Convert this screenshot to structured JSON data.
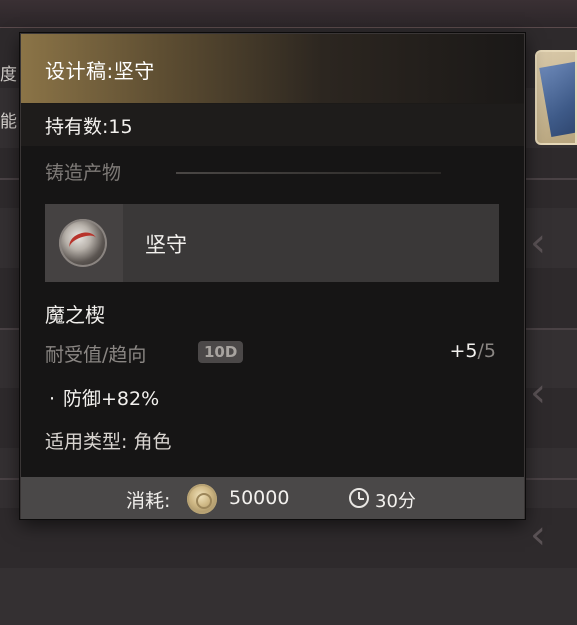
{
  "background": {
    "left_fragments": [
      "度",
      "能"
    ]
  },
  "card": {
    "title": "设计稿:坚守",
    "held_label": "持有数:15",
    "section_title": "铸造产物",
    "product": {
      "name": "坚守",
      "icon": "amulet-icon"
    },
    "item_name": "魔之楔",
    "durability": {
      "label": "耐受值/趋向",
      "badge": "10D",
      "current": "+5",
      "max": "/5"
    },
    "stat": {
      "bullet": "·",
      "text": "防御+82%"
    },
    "type_line": "适用类型: 角色",
    "footer": {
      "cost_label": "消耗:",
      "coin_icon": "coin-icon",
      "cost_value": "50000",
      "clock_icon": "clock-icon",
      "time_value": "30分"
    }
  },
  "colors": {
    "header_gold": "#8b7447",
    "card_bg": "#161515",
    "footer_bg": "#4a4848"
  }
}
